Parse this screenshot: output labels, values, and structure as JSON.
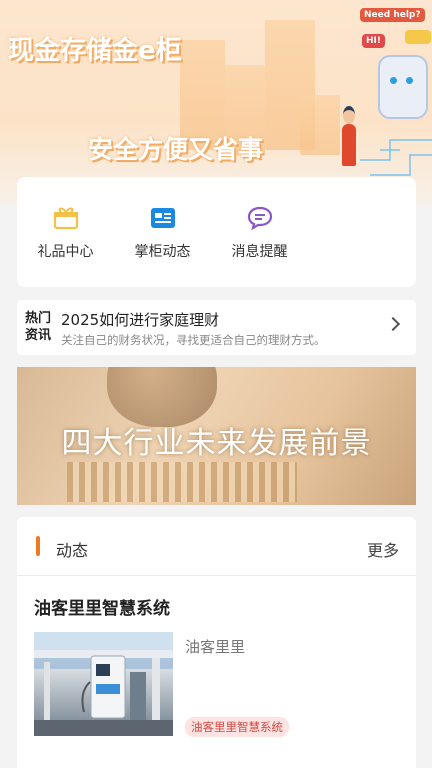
{
  "hero": {
    "title": "现金存储金e柜",
    "subtitle": "安全方便又省事",
    "bubbles": [
      "Need help?",
      "HI!"
    ]
  },
  "quick_actions": [
    {
      "label": "礼品中心",
      "icon": "gift-icon",
      "color": "#f3c148"
    },
    {
      "label": "掌柜动态",
      "icon": "news-card-icon",
      "color": "#1a8ae0"
    },
    {
      "label": "消息提醒",
      "icon": "message-icon",
      "color": "#8a57c9"
    }
  ],
  "news": {
    "badge_line1": "热门",
    "badge_line2": "资讯",
    "title": "2025如何进行家庭理财",
    "description": "关注自己的财务状况，寻找更适合自己的理财方式。"
  },
  "banner": {
    "text": "四大行业未来发展前景"
  },
  "feed": {
    "title": "动态",
    "more": "更多",
    "accent": "#f07a23",
    "post": {
      "title": "油客里里智慧系统",
      "source": "油客里里",
      "tag": "油客里里智慧系统"
    }
  }
}
